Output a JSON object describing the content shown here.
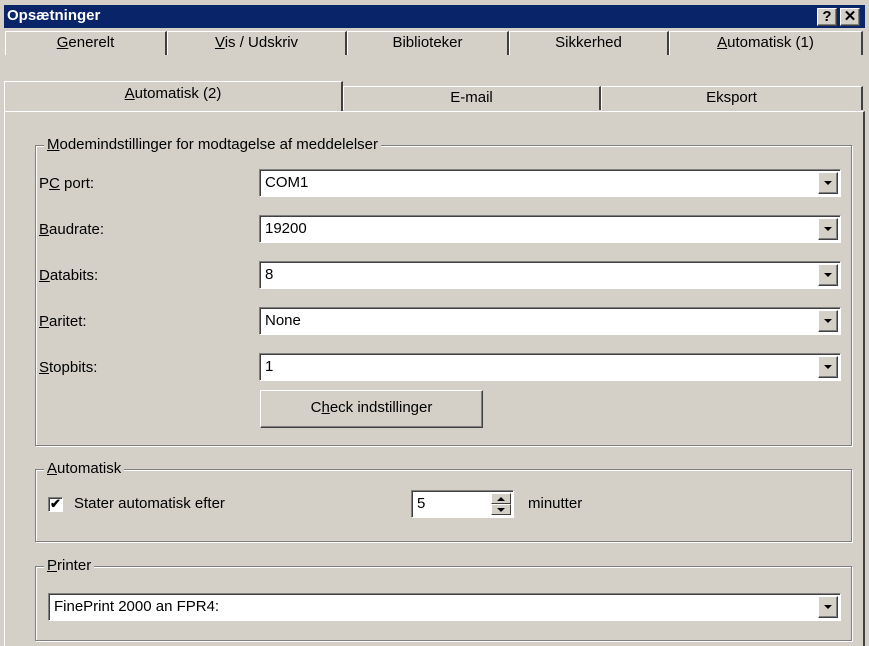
{
  "window": {
    "title": "Opsætninger",
    "help_label": "?",
    "close_label": "✕"
  },
  "tabs": {
    "row1": [
      {
        "pre": "",
        "acc": "G",
        "post": "enerelt"
      },
      {
        "pre": "",
        "acc": "V",
        "post": "is / Udskriv"
      },
      {
        "pre": "Biblioteker",
        "acc": "",
        "post": ""
      },
      {
        "pre": "Sikkerhed",
        "acc": "",
        "post": ""
      },
      {
        "pre": "",
        "acc": "A",
        "post": "utomatisk (1)"
      }
    ],
    "row2": [
      {
        "pre": "",
        "acc": "A",
        "post": "utomatisk (2)"
      },
      {
        "pre": "E-mail",
        "acc": "",
        "post": ""
      },
      {
        "pre": "Eksport",
        "acc": "",
        "post": ""
      }
    ]
  },
  "modem": {
    "legend_acc": "M",
    "legend_rest": "odemindstillinger for modtagelse af meddelelser",
    "fields": [
      {
        "lbl_pre": "P",
        "lbl_acc": "C",
        "lbl_post": " port:",
        "value": "COM1"
      },
      {
        "lbl_pre": "",
        "lbl_acc": "B",
        "lbl_post": "audrate:",
        "value": "19200"
      },
      {
        "lbl_pre": "",
        "lbl_acc": "D",
        "lbl_post": "atabits:",
        "value": "8"
      },
      {
        "lbl_pre": "",
        "lbl_acc": "P",
        "lbl_post": "aritet:",
        "value": "None"
      },
      {
        "lbl_pre": "",
        "lbl_acc": "S",
        "lbl_post": "topbits:",
        "value": "1"
      }
    ],
    "check_btn": {
      "pre": "C",
      "acc": "h",
      "post": "eck indstillinger"
    }
  },
  "auto": {
    "legend_acc": "A",
    "legend_rest": "utomatisk",
    "checkbox_label": "Stater automatisk efter",
    "checked_mark": "✔",
    "minutes": "5",
    "unit": "minutter"
  },
  "printer": {
    "legend_acc": "P",
    "legend_rest": "rinter",
    "value": "FinePrint 2000 an FPR4:"
  }
}
